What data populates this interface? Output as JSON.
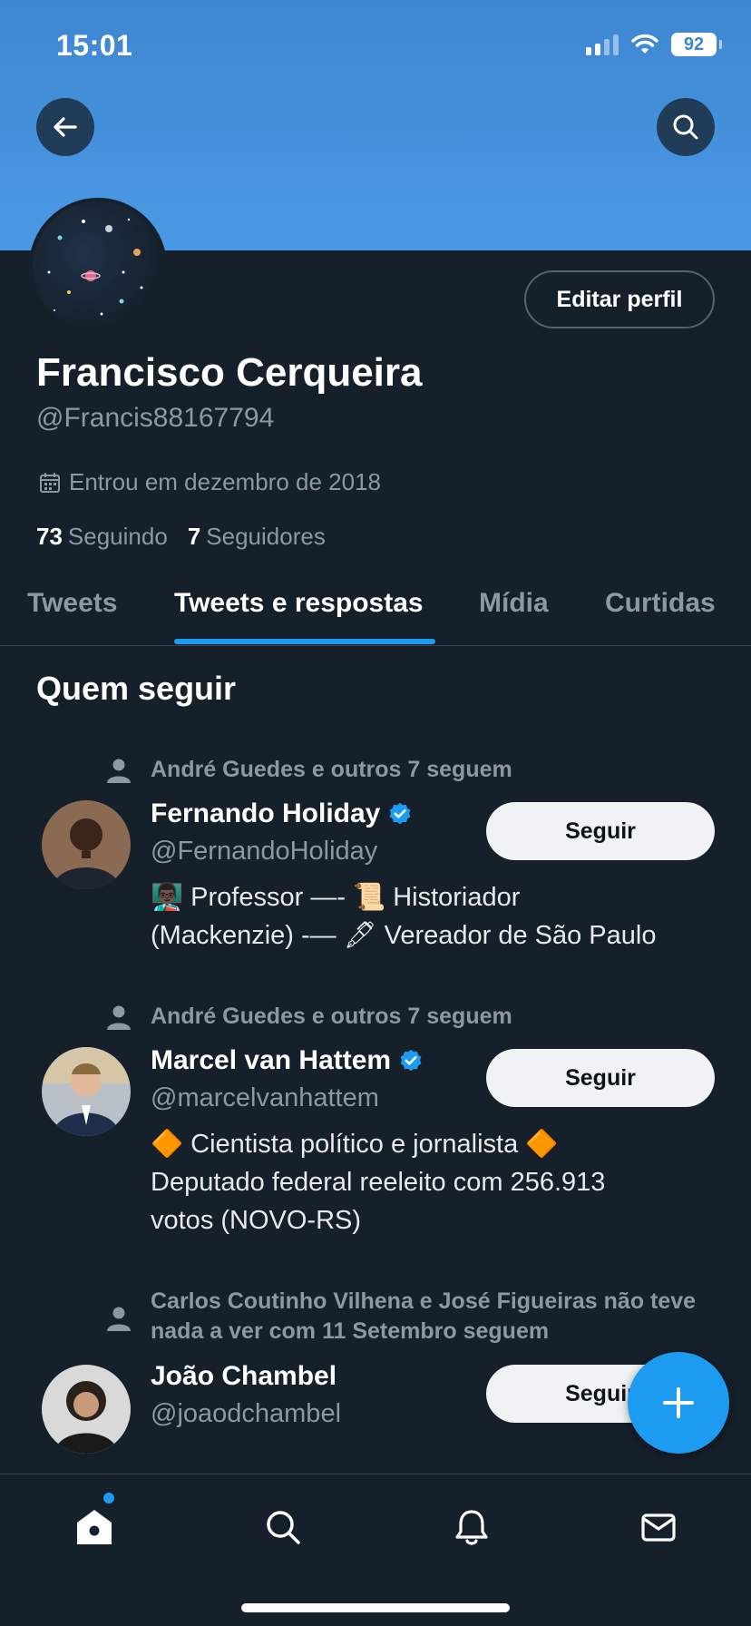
{
  "status_bar": {
    "time": "15:01",
    "battery": "92"
  },
  "profile": {
    "name": "Francisco Cerqueira",
    "handle": "@Francis88167794",
    "edit_label": "Editar perfil",
    "joined": "Entrou em dezembro de 2018",
    "following_count": "73",
    "following_label": "Seguindo",
    "followers_count": "7",
    "followers_label": "Seguidores"
  },
  "tabs": [
    {
      "label": "Tweets",
      "active": false
    },
    {
      "label": "Tweets e respostas",
      "active": true
    },
    {
      "label": "Mídia",
      "active": false
    },
    {
      "label": "Curtidas",
      "active": false
    }
  ],
  "who_to_follow": {
    "title": "Quem seguir",
    "suggestions": [
      {
        "social_context": "André Guedes e outros 7 seguem",
        "name": "Fernando Holiday",
        "verified": true,
        "handle": "@FernandoHoliday",
        "bio_line1": "👨🏿‍🏫 Professor —- 📜 Historiador",
        "bio_line2": "(Mackenzie) -— 🖋 Vereador de São Paulo",
        "bio_line3": "",
        "button": "Seguir"
      },
      {
        "social_context": "André Guedes e outros 7 seguem",
        "name": "Marcel van Hattem",
        "verified": true,
        "handle": "@marcelvanhattem",
        "bio_line1": "🔶 Cientista político e jornalista 🔶",
        "bio_line2": "Deputado federal reeleito com 256.913",
        "bio_line3": "votos (NOVO-RS)",
        "button": "Seguir"
      },
      {
        "social_context": "Carlos Coutinho Vilhena e José Figueiras não teve nada a ver com 11 Setembro seguem",
        "name": "João Chambel",
        "verified": false,
        "handle": "@joaodchambel",
        "button": "Seguir"
      }
    ]
  },
  "colors": {
    "accent": "#1d9bf0",
    "background": "#15202b",
    "secondary_text": "#8b98a5"
  }
}
